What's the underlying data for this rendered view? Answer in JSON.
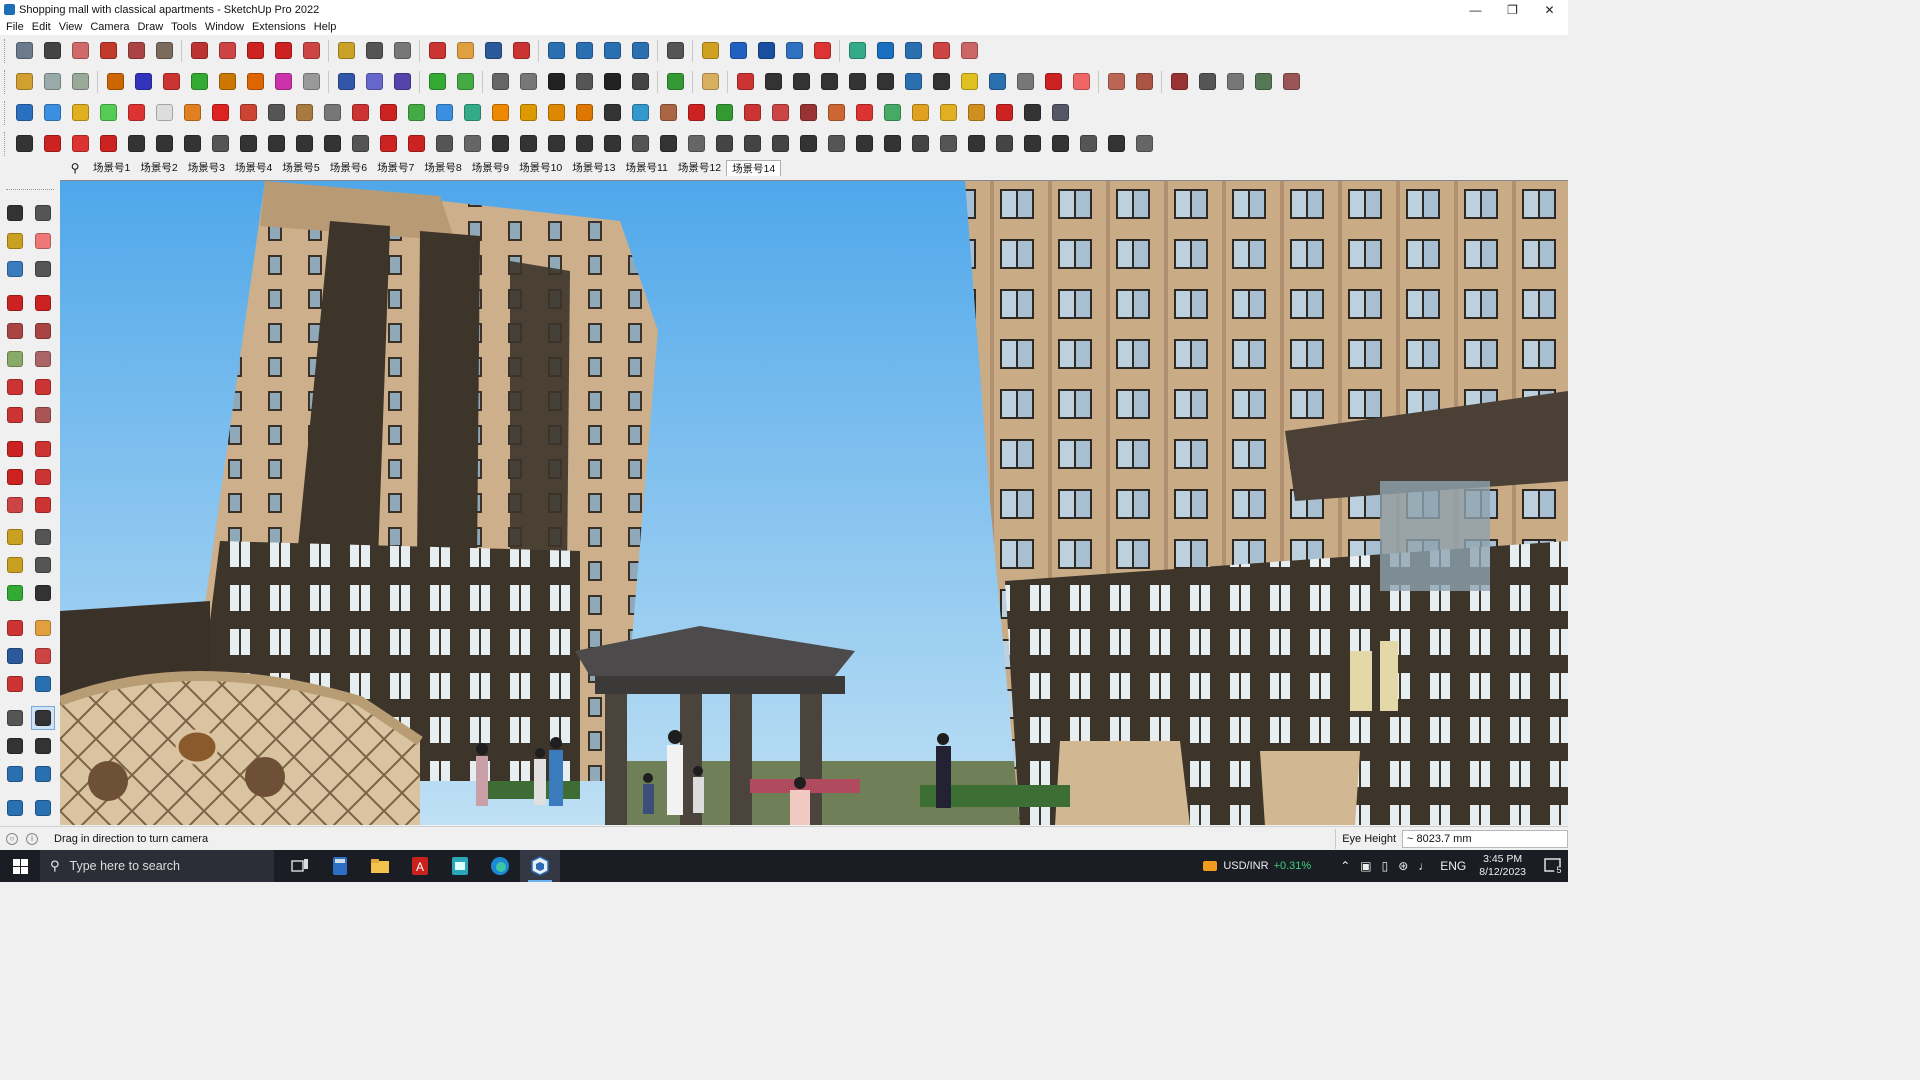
{
  "window": {
    "title": "Shopping mall with classical apartments - SketchUp Pro 2022"
  },
  "menu": [
    "File",
    "Edit",
    "View",
    "Camera",
    "Draw",
    "Tools",
    "Window",
    "Extensions",
    "Help"
  ],
  "scenes": {
    "tabs": [
      "场景号1",
      "场景号2",
      "场景号3",
      "场景号4",
      "场景号5",
      "场景号6",
      "场景号7",
      "场景号8",
      "场景号9",
      "场景号10",
      "场景号13",
      "场景号11",
      "场景号12",
      "场景号14"
    ],
    "active": "场景号14"
  },
  "status": {
    "message": "Drag in direction to turn camera",
    "vcb_label": "Eye Height",
    "vcb_value": "~ 8023.7 mm"
  },
  "taskbar": {
    "search_placeholder": "Type here to search",
    "ticker_name": "USD/INR",
    "ticker_change": "+0.31%",
    "language": "ENG",
    "time": "3:45 PM",
    "date": "8/12/2023",
    "notification_count": "5"
  },
  "colors": {
    "sky": "#5fb0ea",
    "facade_beige": "#cdb08b",
    "facade_dark": "#3d342a",
    "accent_active": "#cfe3f7"
  }
}
